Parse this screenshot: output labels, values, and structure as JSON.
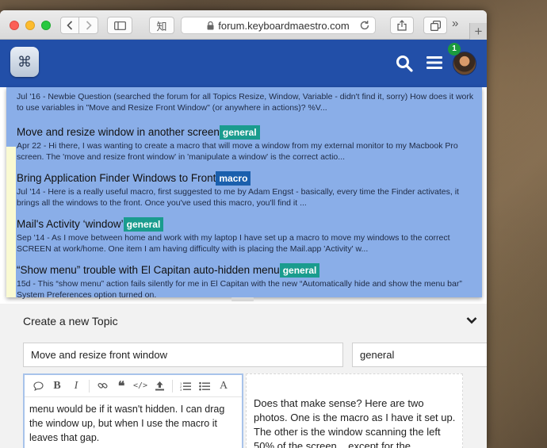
{
  "browser": {
    "url": "forum.keyboardmaestro.com",
    "reader_label": "知"
  },
  "header": {
    "notification_count": "1"
  },
  "results": [
    {
      "title": "",
      "tag": "",
      "snippet": "Jul '16 - Newbie Question (searched the forum for all Topics Resize, Window, Variable - didn't find it, sorry) How does it work to use variables in \"Move and Resize Front Window\" (or anywhere in actions)? %V..."
    },
    {
      "title": "Move and resize window in another screen",
      "tag": "general",
      "snippet": "Apr 22 - Hi there, I was wanting to create a macro that will move a window from my external monitor to my Macbook Pro screen. The 'move and resize front window' in 'manipulate a window' is the correct actio..."
    },
    {
      "title": "Bring Application Finder Windows to Front",
      "tag": "macro",
      "snippet": "Jul '14 - Here is a really useful macro, first suggested to me by Adam Engst - basically, every time the Finder activates, it brings all the windows to the front. Once you've used this macro, you'll find it ..."
    },
    {
      "title": "Mail's Activity ‘window’",
      "tag": "general",
      "snippet": "Sep '14 - As I move between home and work with my laptop I have set up a macro to move my windows to the correct SCREEN at work/home. One item I am having difficulty with is placing the Mail.app 'Activity' w..."
    },
    {
      "title": "“Show menu” trouble with El Capitan auto-hidden menu",
      "tag": "general",
      "snippet": "15d - This “show menu” action fails silently for me in El Capitan with the new “Automatically hide and show the menu bar” System Preferences option turned on."
    }
  ],
  "composer": {
    "heading": "Create a new Topic",
    "title_value": "Move and resize front window",
    "category_value": "general",
    "editor_text": "menu would be if it wasn't hidden. I can drag the window up, but when I use the macro it leaves that gap.",
    "preview_text": "Does that make sense? Here are two photos. One is the macro as I have it set up. The other is the window scanning the left 50% of the screen... except for the"
  },
  "colors": {
    "header_bg": "#224fa8",
    "results_bg": "#8aaee8",
    "tag_general": "#1a9c8e",
    "tag_macro": "#1a5fad",
    "notification": "#1b9a3e"
  }
}
